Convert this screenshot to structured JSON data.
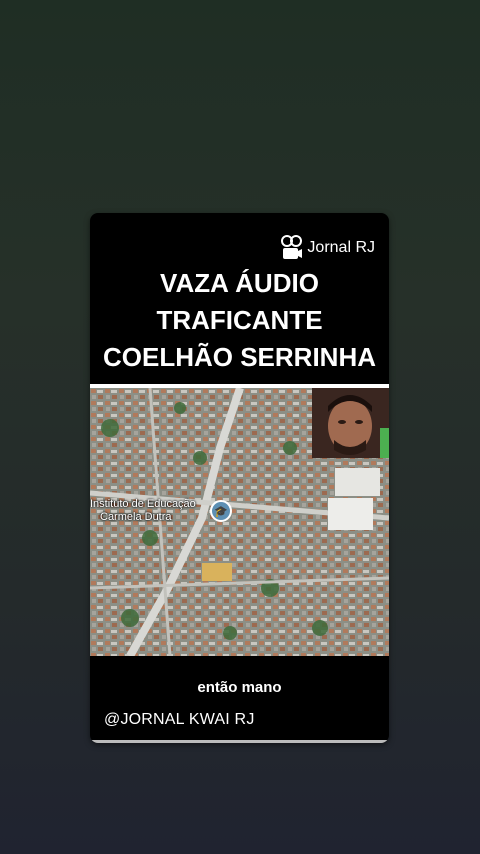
{
  "brand": {
    "name": "Jornal RJ",
    "icon": "camera-reel-icon"
  },
  "headline": [
    "VAZA ÁUDIO",
    "TRAFICANTE",
    "COELHÃO SERRINHA"
  ],
  "map": {
    "place_label": [
      "Instituto de Educação",
      "Carmela Dutra"
    ],
    "pin_icon": "graduation-cap-icon"
  },
  "caption": "então mano",
  "handle": "@JORNAL KWAI RJ",
  "colors": {
    "card": "#000000",
    "text": "#ffffff",
    "road": "#d8d8d4",
    "pin": "#5d8fb3"
  }
}
